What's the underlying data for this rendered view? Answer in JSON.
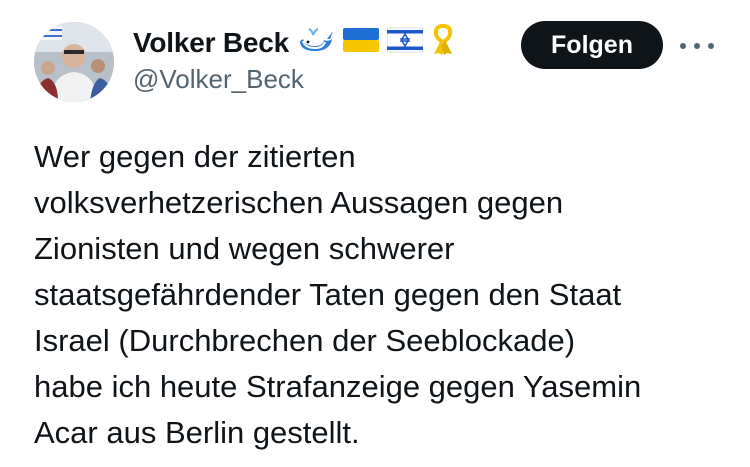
{
  "author": {
    "display_name": "Volker Beck",
    "handle": "@Volker_Beck",
    "badges": [
      "whale-emoji",
      "ukraine-flag-emoji",
      "israel-flag-emoji",
      "yellow-ribbon-emoji"
    ]
  },
  "actions": {
    "follow_label": "Folgen",
    "more_icon": "more-dots-icon"
  },
  "tweet": {
    "lines": [
      "Wer gegen der zitierten",
      "volksverhetzerischen Aussagen gegen",
      "Zionisten und wegen schwerer",
      "staatsgefährdender Taten gegen den Staat",
      "Israel (Durchbrechen der Seeblockade)",
      "habe ich heute Strafanzeige gegen Yasemin",
      "Acar aus Berlin gestellt."
    ]
  },
  "colors": {
    "text": "#0f1419",
    "secondary": "#536471",
    "button_bg": "#0f1419",
    "button_text": "#ffffff"
  }
}
